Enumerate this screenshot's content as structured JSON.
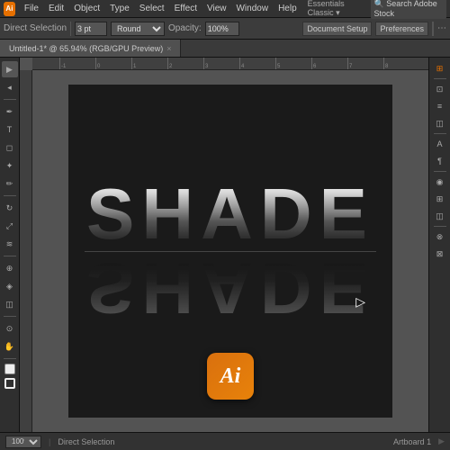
{
  "app": {
    "title": "Adobe Illustrator",
    "icon_label": "Ai",
    "accent_color": "#e67000"
  },
  "menu_bar": {
    "items": [
      "File",
      "Edit",
      "Object",
      "Type",
      "Select",
      "Effect",
      "View",
      "Window",
      "Help"
    ]
  },
  "toolbar": {
    "tool_label": "Direct Selection",
    "stroke_value": "3 pt",
    "stroke_type": "Round",
    "opacity_label": "Opacity:",
    "opacity_value": "100%",
    "doc_setup_label": "Document Setup",
    "preferences_label": "Preferences"
  },
  "tab": {
    "title": "Untitled-1* @ 65.94% (RGB/GPU Preview)",
    "close_label": "×"
  },
  "canvas": {
    "zoom_level": "100%"
  },
  "artwork": {
    "text": "SHADE",
    "reflection_text": "SHADE"
  },
  "ai_logo": {
    "label": "Ai"
  },
  "left_tools": [
    "▶",
    "✎",
    "T",
    "◻",
    "✦",
    "✂",
    "⬦",
    "⊕",
    "◎",
    "✏",
    "↕",
    "☰",
    "▲",
    "⊘"
  ],
  "right_panel": [
    "⊞",
    "⊞",
    "◫",
    "⊡",
    "≡",
    "⊕",
    "◈",
    "⊙",
    "⊗",
    "⊠"
  ],
  "status_bar": {
    "zoom": "100%",
    "tool_name": "Direct Selection",
    "artboard_info": "Artboard 1"
  }
}
